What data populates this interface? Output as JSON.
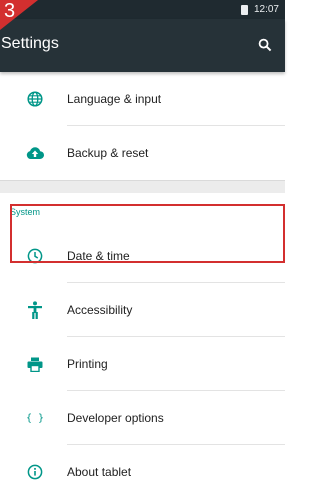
{
  "step_badge": {
    "number": "3",
    "color": "#d32f2f"
  },
  "status_bar": {
    "time": "12:07",
    "icons": [
      "battery-icon"
    ]
  },
  "toolbar": {
    "title": "Settings",
    "icon": "search-icon"
  },
  "accent_color": "#009688",
  "items_top": [
    {
      "label": "Language & input",
      "icon": "globe-icon"
    },
    {
      "label": "Backup & reset",
      "icon": "cloud-upload-icon"
    }
  ],
  "section": {
    "title": "System"
  },
  "items_system": [
    {
      "label": "Date & time",
      "icon": "clock-icon",
      "highlighted": true
    },
    {
      "label": "Accessibility",
      "icon": "accessibility-icon"
    },
    {
      "label": "Printing",
      "icon": "printer-icon"
    },
    {
      "label": "Developer options",
      "icon": "braces-icon",
      "glyph": "{ }"
    },
    {
      "label": "About tablet",
      "icon": "info-icon"
    }
  ]
}
